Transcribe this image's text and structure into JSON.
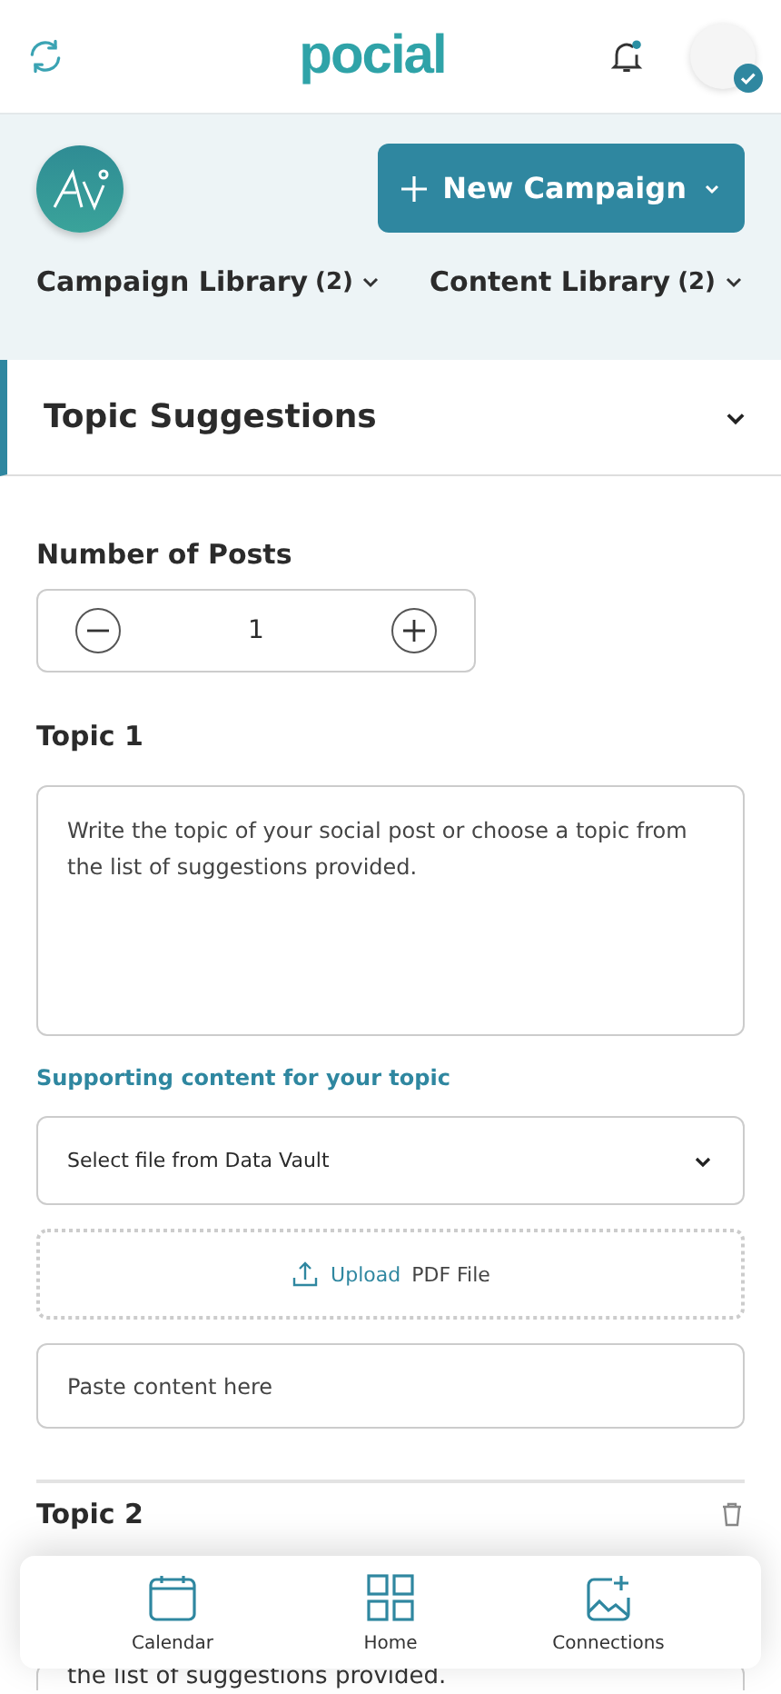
{
  "header": {
    "logo": "pocial",
    "notification_dot": true
  },
  "toolbar": {
    "new_campaign": "New Campaign",
    "libraries": [
      {
        "label": "Campaign Library",
        "count": "(2)"
      },
      {
        "label": "Content Library",
        "count": "(2)"
      }
    ]
  },
  "section": {
    "title": "Topic Suggestions",
    "expanded": true
  },
  "posts": {
    "label": "Number of Posts",
    "value": "1"
  },
  "topics": [
    {
      "title": "Topic 1",
      "placeholder": "Write the topic of your social post or choose a topic from the list of suggestions provided.",
      "supporting_label": "Supporting content for your topic",
      "vault_select": "Select file from Data Vault",
      "upload_link": "Upload",
      "upload_text": "PDF File",
      "paste_placeholder": "Paste content here"
    },
    {
      "title": "Topic 2",
      "visible_text": "the list of suggestions provided."
    }
  ],
  "bottom_nav": [
    {
      "label": "Calendar"
    },
    {
      "label": "Home"
    },
    {
      "label": "Connections"
    }
  ]
}
